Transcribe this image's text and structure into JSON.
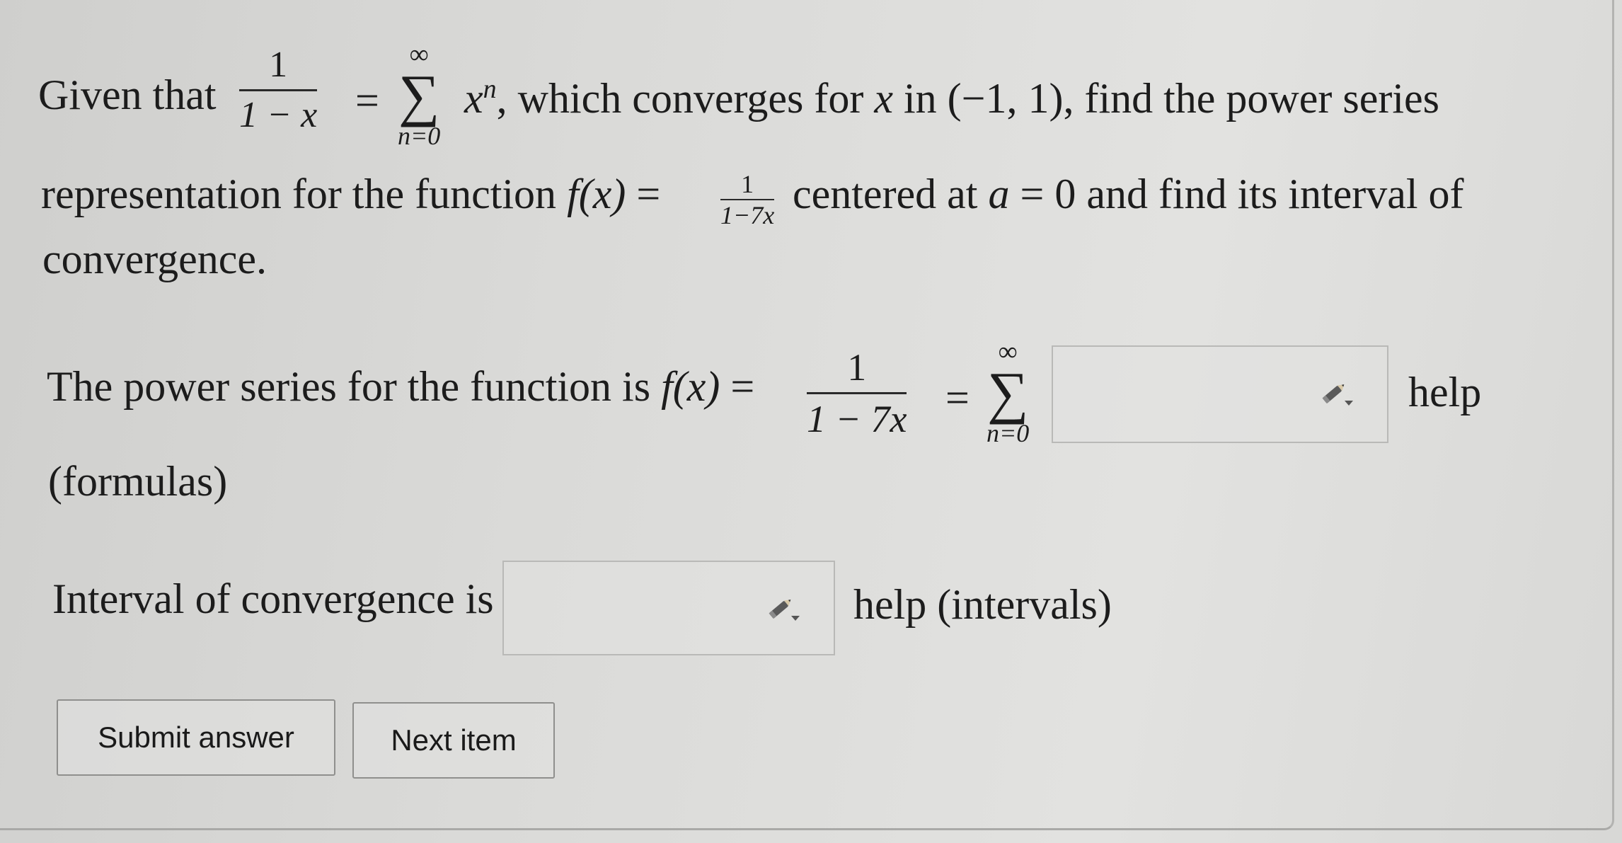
{
  "problem": {
    "given_prefix": "Given that",
    "given_frac_num": "1",
    "given_frac_den": "1 − x",
    "eq1": "=",
    "sum1_upper": "∞",
    "sum1_lower": "n=0",
    "sum_symbol": "∑",
    "sum1_term": "x",
    "sum1_term_power": "n",
    "line1_rest_a": ", which converges for ",
    "line1_var": "x",
    "line1_rest_b": " in (−1, 1), find the power series",
    "line2_a": "representation for the function ",
    "fx": "f(x)",
    "eq2": " = ",
    "line2_frac_num": "1",
    "line2_frac_den": "1−7x",
    "line2_b": " centered at ",
    "line2_a_var": "a",
    "line2_c": " = 0 and find its interval of",
    "line3": "convergence."
  },
  "series_question": {
    "label": "The power series for the function is ",
    "fx": "f(x)",
    "eq": " =",
    "frac_num": "1",
    "frac_den": "1 − 7x",
    "eq2": "=",
    "sum_upper": "∞",
    "sum_lower": "n=0",
    "help_link": "help",
    "formulas_link": "(formulas)",
    "answer_value": ""
  },
  "interval_question": {
    "label": "Interval of convergence is",
    "help_link": "help (intervals)",
    "answer_value": ""
  },
  "buttons": {
    "submit": "Submit answer",
    "next": "Next item"
  }
}
